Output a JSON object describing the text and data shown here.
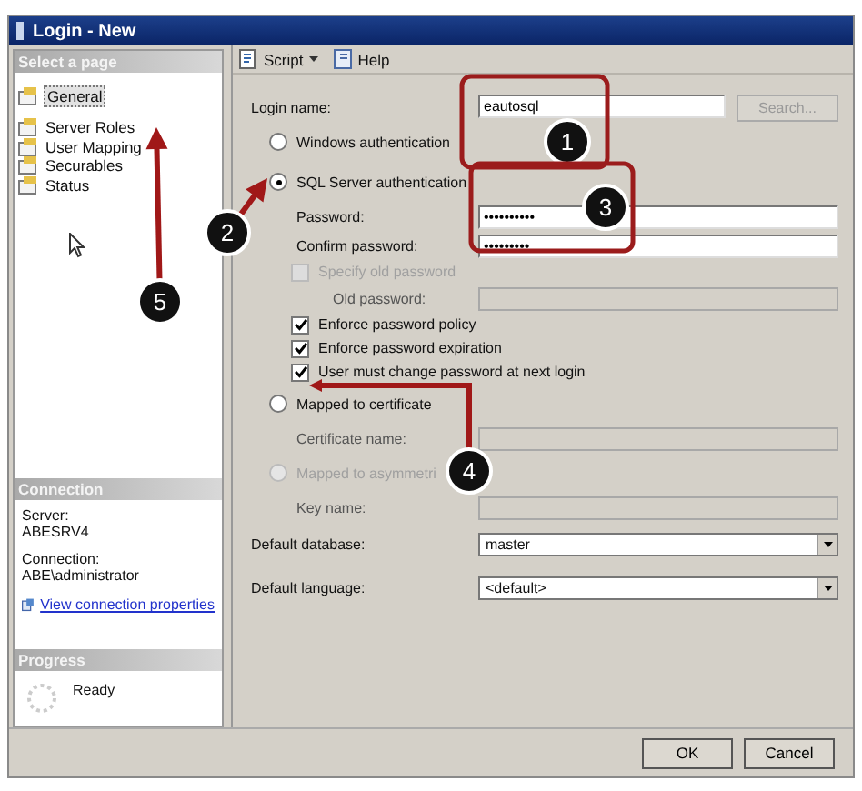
{
  "window": {
    "title": "Login - New"
  },
  "sidebar": {
    "header": "Select a page",
    "items": [
      {
        "label": "General",
        "selected": true
      },
      {
        "label": "Server Roles",
        "selected": false
      },
      {
        "label": "User Mapping",
        "selected": false
      },
      {
        "label": "Securables",
        "selected": false
      },
      {
        "label": "Status",
        "selected": false
      }
    ]
  },
  "connection": {
    "header": "Connection",
    "server_label": "Server:",
    "server": "ABESRV4",
    "connection_label": "Connection:",
    "connection": "ABE\\administrator",
    "link": "View connection properties"
  },
  "progress": {
    "header": "Progress",
    "status": "Ready"
  },
  "toolbar": [
    {
      "label": "Script",
      "dropdown": true
    },
    {
      "label": "Help",
      "dropdown": false
    }
  ],
  "form": [
    {
      "kind": "field",
      "label": "Login name:",
      "value": "eautosql",
      "disabled": false,
      "button": "Search..."
    },
    {
      "kind": "radio",
      "label": "Windows authentication",
      "selected": false,
      "disabled": false
    },
    {
      "kind": "radio",
      "label": "SQL Server authentication",
      "selected": true,
      "disabled": false
    },
    {
      "kind": "subfield",
      "label": "Password:",
      "value": "••••••••••",
      "disabled": false
    },
    {
      "kind": "subfield",
      "label": "Confirm password:",
      "value": "•••••••••",
      "disabled": false
    },
    {
      "kind": "check",
      "label": "Specify old password",
      "checked": false,
      "disabled": true
    },
    {
      "kind": "deepfield",
      "label": "Old password:",
      "disabled": true
    },
    {
      "kind": "check",
      "label": "Enforce password policy",
      "checked": true,
      "disabled": false
    },
    {
      "kind": "check",
      "label": "Enforce password expiration",
      "checked": true,
      "disabled": false
    },
    {
      "kind": "check",
      "label": "User must change password at next login",
      "checked": true,
      "disabled": false
    },
    {
      "kind": "radio",
      "label": "Mapped to certificate",
      "selected": false,
      "disabled": false
    },
    {
      "kind": "subfield",
      "label": "Certificate name:",
      "disabled": true
    },
    {
      "kind": "radio",
      "label": "Mapped to asymmetri",
      "selected": false,
      "disabled": true
    },
    {
      "kind": "subfield",
      "label": "Key name:",
      "disabled": true
    },
    {
      "kind": "select",
      "label": "Default database:",
      "value": "master"
    },
    {
      "kind": "select",
      "label": "Default language:",
      "value": "<default>"
    }
  ],
  "buttons": [
    "OK",
    "Cancel"
  ],
  "callouts": [
    {
      "number": "1"
    },
    {
      "number": "2"
    },
    {
      "number": "3"
    },
    {
      "number": "4"
    },
    {
      "number": "5"
    }
  ]
}
